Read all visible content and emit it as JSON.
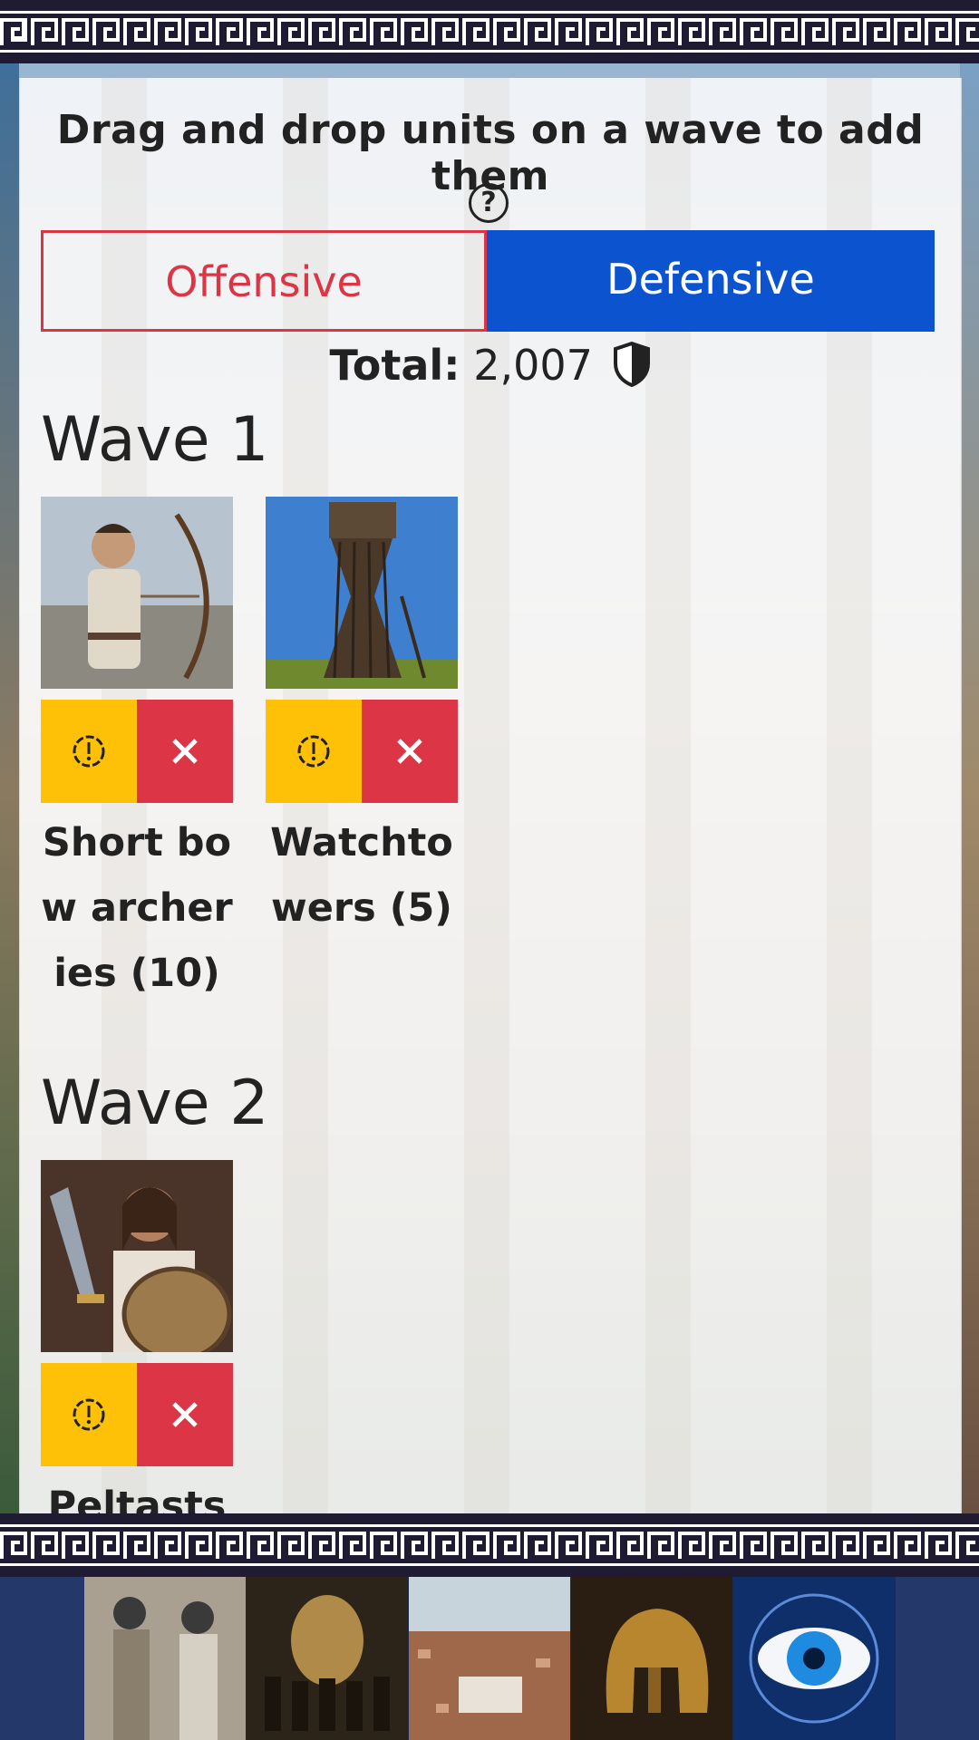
{
  "instructions": "Drag and drop units on a wave to add them",
  "help_icon": "question-circle-icon",
  "tabs": {
    "offensive": "Offensive",
    "defensive": "Defensive",
    "active": "defensive"
  },
  "total": {
    "label": "Total:",
    "value": "2,007",
    "icon": "shield-icon"
  },
  "waves": [
    {
      "title": "Wave 1",
      "units": [
        {
          "name": "Short bow archeries (10)",
          "image": "archer-image"
        },
        {
          "name": "Watchtowers (5)",
          "image": "watchtower-image"
        }
      ]
    },
    {
      "title": "Wave 2",
      "units": [
        {
          "name": "Peltasts",
          "image": "peltast-image"
        }
      ]
    }
  ],
  "bottom_nav": [
    {
      "icon": "diplomacy-image"
    },
    {
      "icon": "army-image"
    },
    {
      "icon": "city-image"
    },
    {
      "icon": "helmet-image"
    },
    {
      "icon": "eye-image"
    }
  ],
  "colors": {
    "offensive": "#dc3545",
    "defensive": "#0b53cf",
    "info_button": "#ffc107",
    "remove_button": "#dc3545",
    "border": "#1e1b33"
  }
}
